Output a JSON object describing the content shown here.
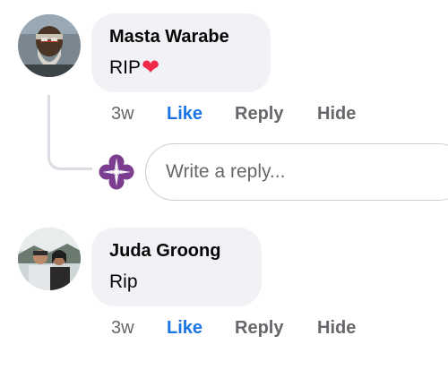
{
  "comments": [
    {
      "author": "Masta Warabe",
      "text": "RIP",
      "emoji": "❤️",
      "time": "3w",
      "actions": {
        "like": "Like",
        "reply": "Reply",
        "hide": "Hide"
      }
    },
    {
      "author": "Juda Groong",
      "text": "Rip",
      "time": "3w",
      "actions": {
        "like": "Like",
        "reply": "Reply",
        "hide": "Hide"
      }
    }
  ],
  "reply_box": {
    "placeholder": "Write a reply..."
  },
  "colors": {
    "link": "#1b74e4",
    "bubble": "#f0f2f5",
    "muted": "#65676b",
    "heart": "#f02849"
  }
}
